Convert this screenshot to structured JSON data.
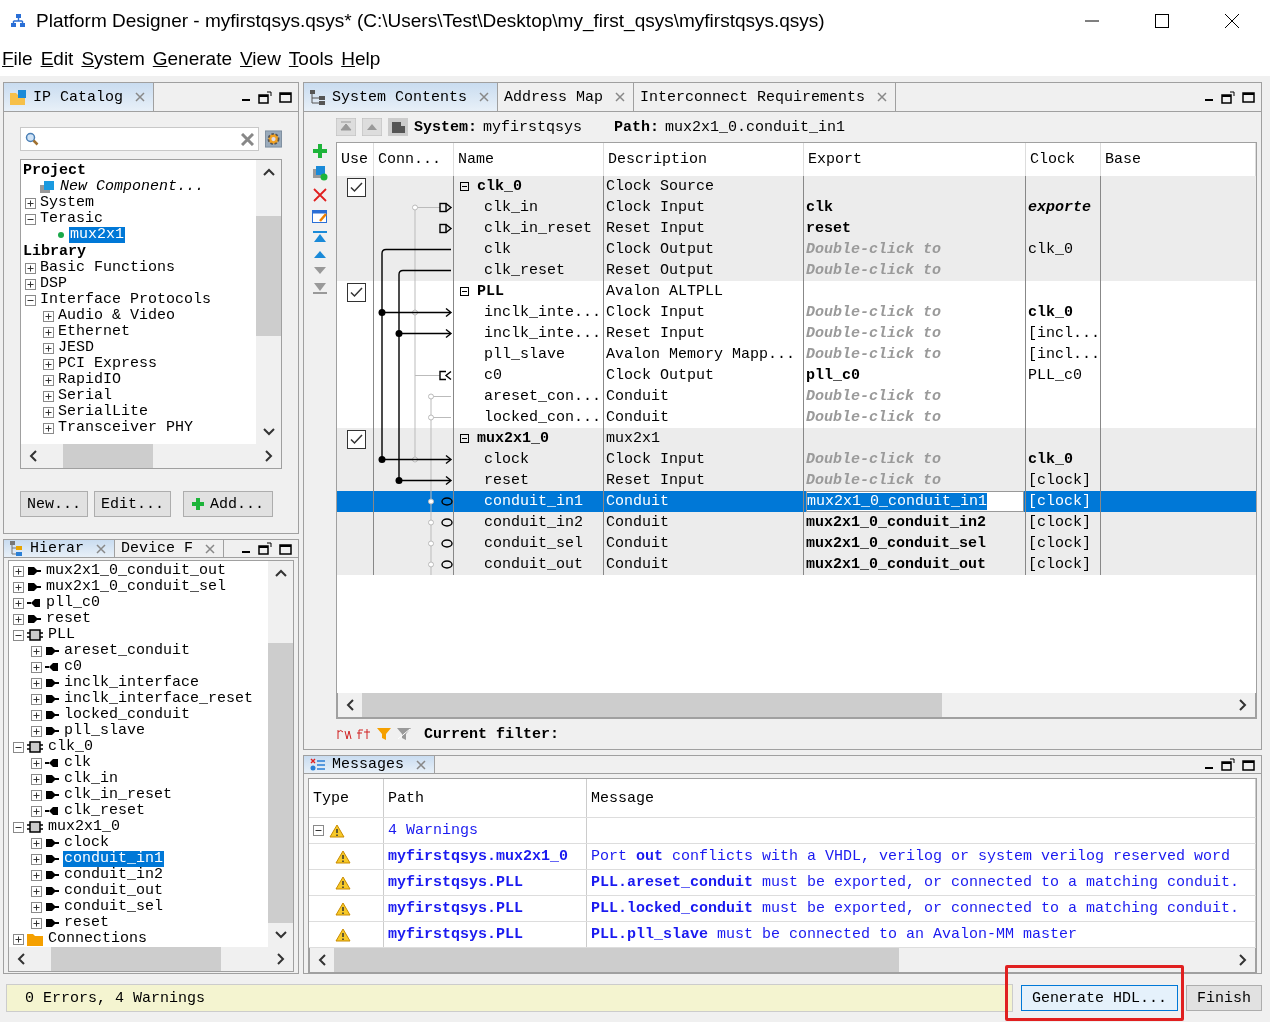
{
  "window": {
    "title": "Platform Designer - myfirstqsys.qsys* (C:\\Users\\Test\\Desktop\\my_first_qsys\\myfirstqsys.qsys)"
  },
  "menu": [
    "File",
    "Edit",
    "System",
    "Generate",
    "View",
    "Tools",
    "Help"
  ],
  "ip_catalog": {
    "tab": "IP Catalog",
    "sections": [
      {
        "heading": "Project",
        "items": [
          {
            "label": "New Component...",
            "kind": "new",
            "selected": false
          },
          {
            "label": "System",
            "expanded": false,
            "selected": false
          },
          {
            "label": "Terasic",
            "expanded": true,
            "selected": false,
            "children": [
              {
                "label": "mux2x1",
                "kind": "ip",
                "selected": true
              }
            ]
          }
        ]
      },
      {
        "heading": "Library",
        "items": [
          {
            "label": "Basic Functions",
            "expanded": false,
            "selected": false
          },
          {
            "label": "DSP",
            "expanded": false,
            "selected": false
          },
          {
            "label": "Interface Protocols",
            "expanded": true,
            "selected": false,
            "children": [
              {
                "label": "Audio & Video",
                "expanded": false,
                "selected": false
              },
              {
                "label": "Ethernet",
                "expanded": false,
                "selected": false
              },
              {
                "label": "JESD",
                "expanded": false,
                "selected": false
              },
              {
                "label": "PCI Express",
                "expanded": false,
                "selected": false
              },
              {
                "label": "RapidIO",
                "expanded": false,
                "selected": false
              },
              {
                "label": "Serial",
                "expanded": false,
                "selected": false
              },
              {
                "label": "SerialLite",
                "expanded": false,
                "selected": false
              },
              {
                "label": "Transceiver PHY",
                "expanded": false,
                "selected": false
              }
            ]
          }
        ]
      }
    ],
    "buttons": [
      "New...",
      "Edit...",
      "Add..."
    ]
  },
  "hierarchy": {
    "tabs": [
      {
        "label": "Hierar",
        "selected": true
      },
      {
        "label": "Device F",
        "selected": false
      }
    ],
    "items": [
      {
        "label": "mux2x1_0_conduit_out",
        "kind": "out",
        "expanded": false,
        "selected": false
      },
      {
        "label": "mux2x1_0_conduit_sel",
        "kind": "out",
        "expanded": false,
        "selected": false
      },
      {
        "label": "pll_c0",
        "kind": "in",
        "expanded": false,
        "selected": false
      },
      {
        "label": "reset",
        "kind": "out",
        "expanded": false,
        "selected": false
      },
      {
        "label": "PLL",
        "kind": "component",
        "expanded": true,
        "selected": false,
        "children": [
          {
            "label": "areset_conduit",
            "kind": "out",
            "expanded": false,
            "selected": false
          },
          {
            "label": "c0",
            "kind": "in",
            "expanded": false,
            "selected": false
          },
          {
            "label": "inclk_interface",
            "kind": "out",
            "expanded": false,
            "selected": false
          },
          {
            "label": "inclk_interface_reset",
            "kind": "out",
            "expanded": false,
            "selected": false
          },
          {
            "label": "locked_conduit",
            "kind": "out",
            "expanded": false,
            "selected": false
          },
          {
            "label": "pll_slave",
            "kind": "out",
            "expanded": false,
            "selected": false
          }
        ]
      },
      {
        "label": "clk_0",
        "kind": "component",
        "expanded": true,
        "selected": false,
        "children": [
          {
            "label": "clk",
            "kind": "in",
            "expanded": false,
            "selected": false
          },
          {
            "label": "clk_in",
            "kind": "out",
            "expanded": false,
            "selected": false
          },
          {
            "label": "clk_in_reset",
            "kind": "out",
            "expanded": false,
            "selected": false
          },
          {
            "label": "clk_reset",
            "kind": "in",
            "expanded": false,
            "selected": false
          }
        ]
      },
      {
        "label": "mux2x1_0",
        "kind": "component",
        "expanded": true,
        "selected": false,
        "children": [
          {
            "label": "clock",
            "kind": "out",
            "expanded": false,
            "selected": false
          },
          {
            "label": "conduit_in1",
            "kind": "out",
            "expanded": false,
            "selected": true
          },
          {
            "label": "conduit_in2",
            "kind": "out",
            "expanded": false,
            "selected": false
          },
          {
            "label": "conduit_out",
            "kind": "out",
            "expanded": false,
            "selected": false
          },
          {
            "label": "conduit_sel",
            "kind": "out",
            "expanded": false,
            "selected": false
          },
          {
            "label": "reset",
            "kind": "out",
            "expanded": false,
            "selected": false
          }
        ]
      },
      {
        "label": "Connections",
        "kind": "folder",
        "expanded": false,
        "selected": false
      }
    ]
  },
  "system_contents": {
    "tabs": [
      {
        "label": "System Contents",
        "selected": true
      },
      {
        "label": "Address Map",
        "selected": false
      },
      {
        "label": "Interconnect Requirements",
        "selected": false
      }
    ],
    "system_label": "System:",
    "system_name": "myfirstqsys",
    "path_label": "Path:",
    "path": "mux2x1_0.conduit_in1",
    "columns": [
      "Use",
      "Conn...",
      "Name",
      "Description",
      "Export",
      "Clock",
      "Base"
    ],
    "groups": [
      {
        "checked": true,
        "rows": [
          {
            "kind": "component",
            "name": "clk_0",
            "description": "Clock Source",
            "selected": false
          },
          {
            "kind": "interface",
            "name": "clk_in",
            "description": "Clock Input",
            "export": {
              "text": "clk",
              "kind": "exported"
            },
            "clock": {
              "text": "exporte",
              "kind": "exported"
            },
            "selected": false
          },
          {
            "kind": "interface",
            "name": "clk_in_reset",
            "description": "Reset Input",
            "export": {
              "text": "reset",
              "kind": "exported"
            },
            "selected": false
          },
          {
            "kind": "interface",
            "name": "clk",
            "description": "Clock Output",
            "export": {
              "text": "Double-click to",
              "kind": "prompt"
            },
            "clock": {
              "text": "clk_0",
              "kind": "derived"
            },
            "selected": false
          },
          {
            "kind": "interface",
            "name": "clk_reset",
            "description": "Reset Output",
            "export": {
              "text": "Double-click to",
              "kind": "prompt"
            },
            "selected": false
          }
        ]
      },
      {
        "checked": true,
        "rows": [
          {
            "kind": "component",
            "name": "PLL",
            "description": "Avalon ALTPLL",
            "selected": false
          },
          {
            "kind": "interface",
            "name": "inclk_inte...",
            "description": "Clock Input",
            "export": {
              "text": "Double-click to",
              "kind": "prompt"
            },
            "clock": {
              "text": "clk_0",
              "kind": "assigned"
            },
            "selected": false
          },
          {
            "kind": "interface",
            "name": "inclk_inte...",
            "description": "Reset Input",
            "export": {
              "text": "Double-click to",
              "kind": "prompt"
            },
            "clock": {
              "text": "[incl...",
              "kind": "derived"
            },
            "selected": false
          },
          {
            "kind": "interface",
            "name": "pll_slave",
            "description": "Avalon Memory Mapp...",
            "export": {
              "text": "Double-click to",
              "kind": "prompt"
            },
            "clock": {
              "text": "[incl...",
              "kind": "derived"
            },
            "selected": false
          },
          {
            "kind": "interface",
            "name": "c0",
            "description": "Clock Output",
            "export": {
              "text": "pll_c0",
              "kind": "exported"
            },
            "clock": {
              "text": "PLL_c0",
              "kind": "derived"
            },
            "selected": false
          },
          {
            "kind": "interface",
            "name": "areset_con...",
            "description": "Conduit",
            "export": {
              "text": "Double-click to",
              "kind": "prompt"
            },
            "selected": false
          },
          {
            "kind": "interface",
            "name": "locked_con...",
            "description": "Conduit",
            "export": {
              "text": "Double-click to",
              "kind": "prompt"
            },
            "selected": false
          }
        ]
      },
      {
        "checked": true,
        "rows": [
          {
            "kind": "component",
            "name": "mux2x1_0",
            "description": "mux2x1",
            "selected": false
          },
          {
            "kind": "interface",
            "name": "clock",
            "description": "Clock Input",
            "export": {
              "text": "Double-click to",
              "kind": "prompt"
            },
            "clock": {
              "text": "clk_0",
              "kind": "assigned"
            },
            "selected": false
          },
          {
            "kind": "interface",
            "name": "reset",
            "description": "Reset Input",
            "export": {
              "text": "Double-click to",
              "kind": "prompt"
            },
            "clock": {
              "text": "[clock]",
              "kind": "derived"
            },
            "selected": false
          },
          {
            "kind": "interface",
            "name": "conduit_in1",
            "description": "Conduit",
            "export": {
              "text": "mux2x1_0_conduit_in1",
              "kind": "editing"
            },
            "clock": {
              "text": "[clock]",
              "kind": "derived"
            },
            "selected": true
          },
          {
            "kind": "interface",
            "name": "conduit_in2",
            "description": "Conduit",
            "export": {
              "text": "mux2x1_0_conduit_in2",
              "kind": "exported"
            },
            "clock": {
              "text": "[clock]",
              "kind": "derived"
            },
            "selected": false
          },
          {
            "kind": "interface",
            "name": "conduit_sel",
            "description": "Conduit",
            "export": {
              "text": "mux2x1_0_conduit_sel",
              "kind": "exported"
            },
            "clock": {
              "text": "[clock]",
              "kind": "derived"
            },
            "selected": false
          },
          {
            "kind": "interface",
            "name": "conduit_out",
            "description": "Conduit",
            "export": {
              "text": "mux2x1_0_conduit_out",
              "kind": "exported"
            },
            "clock": {
              "text": "[clock]",
              "kind": "derived"
            },
            "selected": false
          }
        ]
      }
    ],
    "filter_label": "Current filter:"
  },
  "messages": {
    "tab": "Messages",
    "columns": [
      "Type",
      "Path",
      "Message"
    ],
    "group": {
      "expanded": true,
      "label": "4 Warnings"
    },
    "items": [
      {
        "path": "myfirstqsys.mux2x1_0",
        "message": "Port **out** conflicts with a VHDL, verilog or system verilog reserved word"
      },
      {
        "path": "myfirstqsys.PLL",
        "message": "**PLL.areset_conduit** must be exported, or connected to a matching conduit."
      },
      {
        "path": "myfirstqsys.PLL",
        "message": "**PLL.locked_conduit** must be exported, or connected to a matching conduit."
      },
      {
        "path": "myfirstqsys.PLL",
        "message": "**PLL.pll_slave** must be connected to an Avalon-MM master"
      }
    ]
  },
  "status_bar": {
    "text": "0 Errors, 4 Warnings",
    "buttons": [
      {
        "label": "Generate HDL...",
        "highlighted": true
      },
      {
        "label": "Finish",
        "highlighted": false
      }
    ]
  }
}
